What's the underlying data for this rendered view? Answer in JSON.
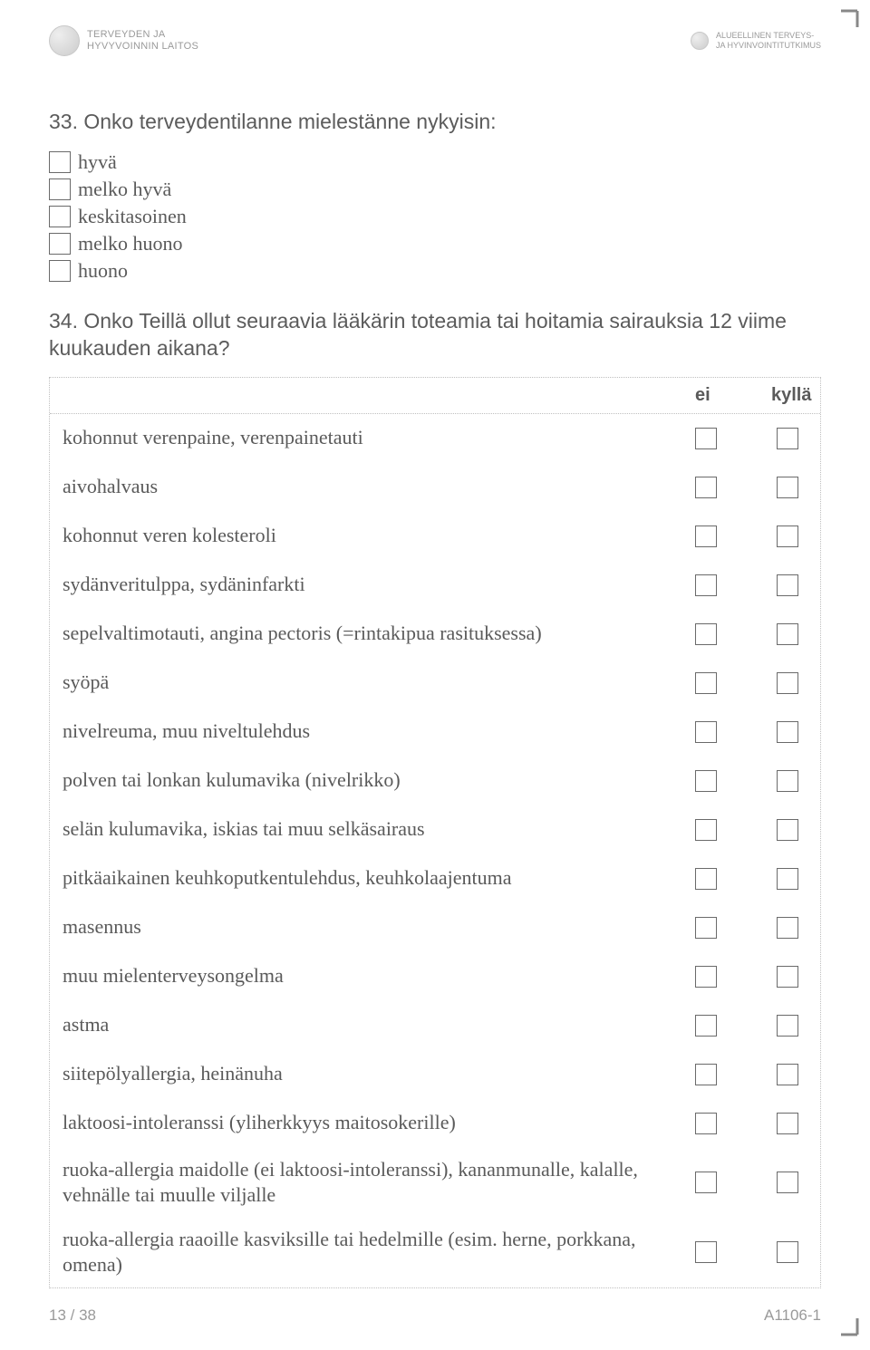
{
  "header": {
    "left_line1": "TERVEYDEN JA",
    "left_line2": "HYVYVOINNIN LAITOS",
    "right_line1": "ALUEELLINEN TERVEYS-",
    "right_line2": "JA HYVINVOINTITUTKIMUS"
  },
  "q33": {
    "title": "33. Onko terveydentilanne mielestänne nykyisin:",
    "options": [
      "hyvä",
      "melko hyvä",
      "keskitasoinen",
      "melko huono",
      "huono"
    ]
  },
  "q34": {
    "title": "34. Onko Teillä ollut seuraavia lääkärin toteamia tai hoitamia sairauksia 12 viime kuukauden aikana?",
    "col_ei": "ei",
    "col_kylla": "kyllä",
    "rows": [
      "kohonnut verenpaine, verenpainetauti",
      "aivohalvaus",
      "kohonnut veren kolesteroli",
      "sydänveritulppa, sydäninfarkti",
      "sepelvaltimotauti, angina pectoris (=rintakipua rasituksessa)",
      "syöpä",
      "nivelreuma, muu niveltulehdus",
      "polven tai lonkan kulumavika (nivelrikko)",
      "selän kulumavika, iskias tai muu selkäsairaus",
      "pitkäaikainen keuhkoputkentulehdus, keuhkolaajentuma",
      "masennus",
      "muu mielenterveysongelma",
      "astma",
      "siitepölyallergia, heinänuha",
      "laktoosi-intoleranssi (yliherkkyys maitosokerille)",
      "ruoka-allergia maidolle (ei laktoosi-intoleranssi), kananmunalle, kalalle, vehnälle tai muulle viljalle",
      "ruoka-allergia raaoille kasviksille tai hedelmille (esim. herne, porkkana, omena)"
    ]
  },
  "footer": {
    "page": "13 / 38",
    "code": "A1106-1"
  }
}
